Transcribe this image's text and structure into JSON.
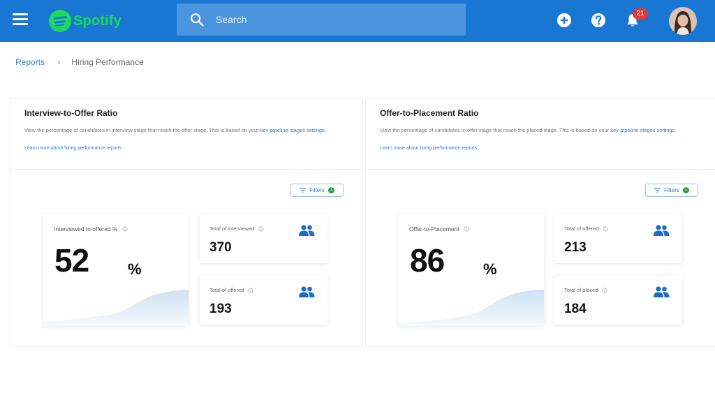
{
  "header": {
    "app_name": "Spotify",
    "search_placeholder": "Search",
    "notification_count": "21",
    "icons": [
      "menu-icon",
      "spotify-logo-icon",
      "search-icon",
      "add-icon",
      "help-icon",
      "bell-icon"
    ],
    "brand_color": "#1877d2",
    "logo_color": "#1ed760"
  },
  "breadcrumb": {
    "parent": "Reports",
    "current": "Hiring Performance"
  },
  "panels": [
    {
      "title": "Interview-to-Offer Ratio",
      "description": "View the percentage of candidates in interview stage that reach the offer stage. This is based on your ",
      "description_link": "key-pipeline stages settings",
      "description_end": ".",
      "learn_more": "Learn more about hiring performance reports",
      "filters_label": "Filters",
      "filters_count": "1",
      "main_metric": {
        "label": "Interviewed to offered %",
        "value": "52",
        "unit": "%"
      },
      "metrics": [
        {
          "label": "Total of interviewed",
          "value": "370"
        },
        {
          "label": "Total of offered",
          "value": "193"
        }
      ]
    },
    {
      "title": "Offer-to-Placement Ratio",
      "description": "View the percentage of candidates in offer stage that reach the placed stage. This is based on your ",
      "description_link": "key-pipeline stages settings",
      "description_end": ".",
      "learn_more": "Learn more about hiring performance reports",
      "filters_label": "Filters",
      "filters_count": "1",
      "main_metric": {
        "label": "Offer-to-Placement",
        "value": "86",
        "unit": "%"
      },
      "metrics": [
        {
          "label": "Total of offered",
          "value": "213"
        },
        {
          "label": "Total of placed",
          "value": "184"
        }
      ]
    }
  ]
}
